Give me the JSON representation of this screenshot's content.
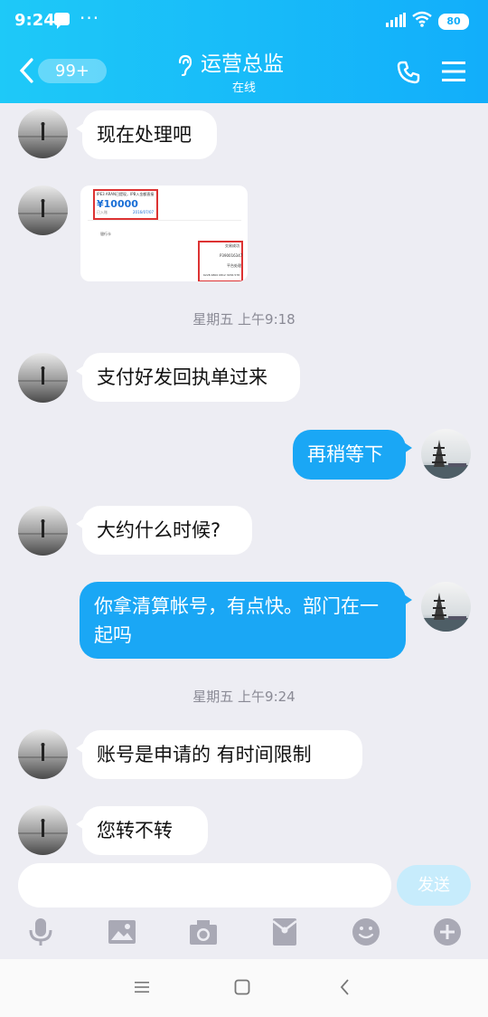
{
  "status_bar": {
    "time": "9:24",
    "dots": "···",
    "battery": "80"
  },
  "header": {
    "back_badge": "99+",
    "title": "运营总监",
    "subtitle": "在线"
  },
  "messages": [
    {
      "side": "in",
      "text": "现在处理吧"
    },
    {
      "side": "in",
      "type": "image",
      "image": {
        "header_text": "IPE3 ARAN已提现，IPB入金额直接",
        "amount": "¥10000",
        "row_left": "已入账",
        "row_mid": "2016/07/07",
        "section": "银行卡",
        "row_values": [
          "交易成功",
          "P390016347",
          "平台处理",
          "6228 4800 0812 3456 578"
        ]
      }
    },
    {
      "side": "time",
      "text": "星期五 上午9:18"
    },
    {
      "side": "in",
      "text": "支付好发回执单过来"
    },
    {
      "side": "out",
      "text": "再稍等下"
    },
    {
      "side": "in",
      "text": "大约什么时候?"
    },
    {
      "side": "out",
      "text": "你拿清算帐号，有点快。部门在一起吗"
    },
    {
      "side": "time",
      "text": "星期五 上午9:24"
    },
    {
      "side": "in",
      "text": "账号是申请的 有时间限制"
    },
    {
      "side": "in",
      "text": "您转不转"
    }
  ],
  "input": {
    "placeholder": "",
    "send_label": "发送"
  },
  "toolbar_icons": [
    "microphone-icon",
    "image-icon",
    "camera-icon",
    "red-packet-icon",
    "emoji-icon",
    "plus-icon"
  ],
  "colors": {
    "header_start": "#1ec9f8",
    "header_end": "#12aefa",
    "outgoing_bubble": "#1aa7f5",
    "background": "#ededf3",
    "send_disabled": "#c7ecfc"
  }
}
